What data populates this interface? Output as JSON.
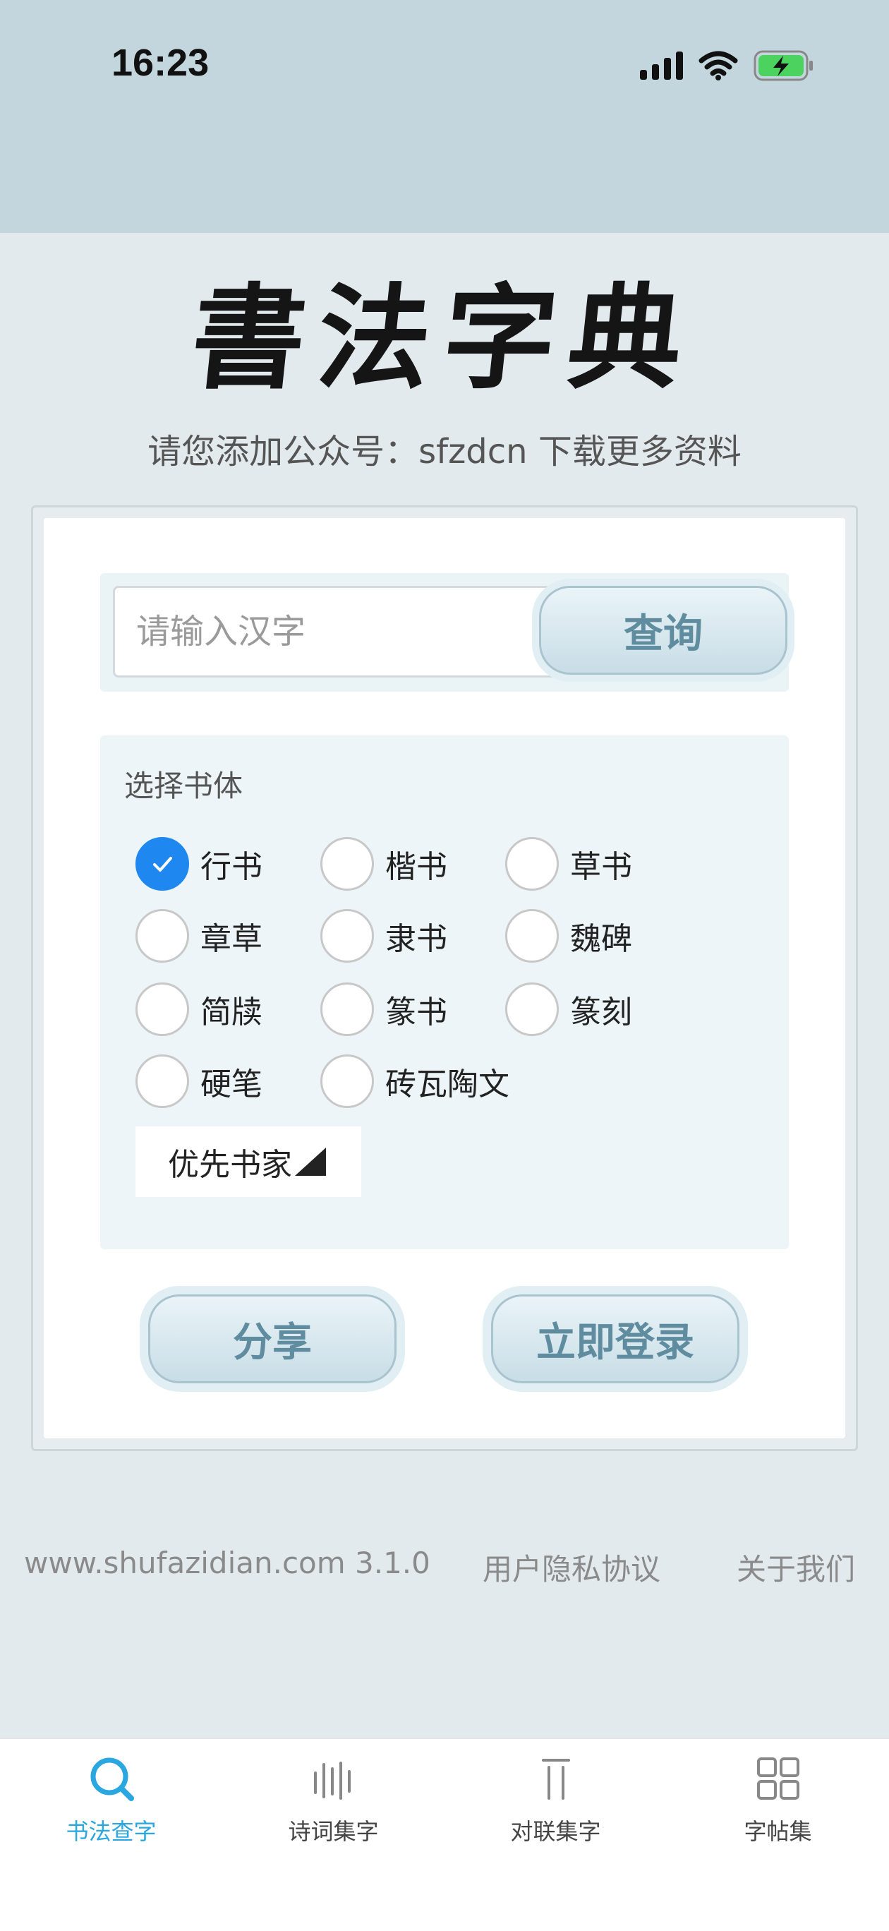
{
  "status_bar": {
    "time": "16:23"
  },
  "header": {
    "logo_text": "書法字典",
    "notice": "请您添加公众号：sfzdcn 下载更多资料"
  },
  "search": {
    "placeholder": "请输入汉字",
    "value": "",
    "button_label": "查询"
  },
  "style_select": {
    "title": "选择书体",
    "options": [
      {
        "label": "行书",
        "checked": true
      },
      {
        "label": "楷书",
        "checked": false
      },
      {
        "label": "草书",
        "checked": false
      },
      {
        "label": "章草",
        "checked": false
      },
      {
        "label": "隶书",
        "checked": false
      },
      {
        "label": "魏碑",
        "checked": false
      },
      {
        "label": "简牍",
        "checked": false
      },
      {
        "label": "篆书",
        "checked": false
      },
      {
        "label": "篆刻",
        "checked": false
      },
      {
        "label": "硬笔",
        "checked": false
      },
      {
        "label": "砖瓦陶文",
        "checked": false
      }
    ],
    "master_label": "优先书家"
  },
  "actions": {
    "share_label": "分享",
    "login_label": "立即登录"
  },
  "footer": {
    "site_version": "www.shufazidian.com 3.1.0",
    "privacy": "用户隐私协议",
    "about": "关于我们"
  },
  "tabbar": {
    "items": [
      {
        "label": "书法查字",
        "icon": "search-icon",
        "active": true
      },
      {
        "label": "诗词集字",
        "icon": "poem-lines-icon",
        "active": false
      },
      {
        "label": "对联集字",
        "icon": "couplet-icon",
        "active": false
      },
      {
        "label": "字帖集",
        "icon": "grid-icon",
        "active": false
      }
    ]
  },
  "colors": {
    "accent": "#1e88f0",
    "tab_active": "#2aa6e0",
    "button_text": "#5f8c9f",
    "status_bg": "#c4d6dd",
    "page_bg": "#e3eaee"
  }
}
